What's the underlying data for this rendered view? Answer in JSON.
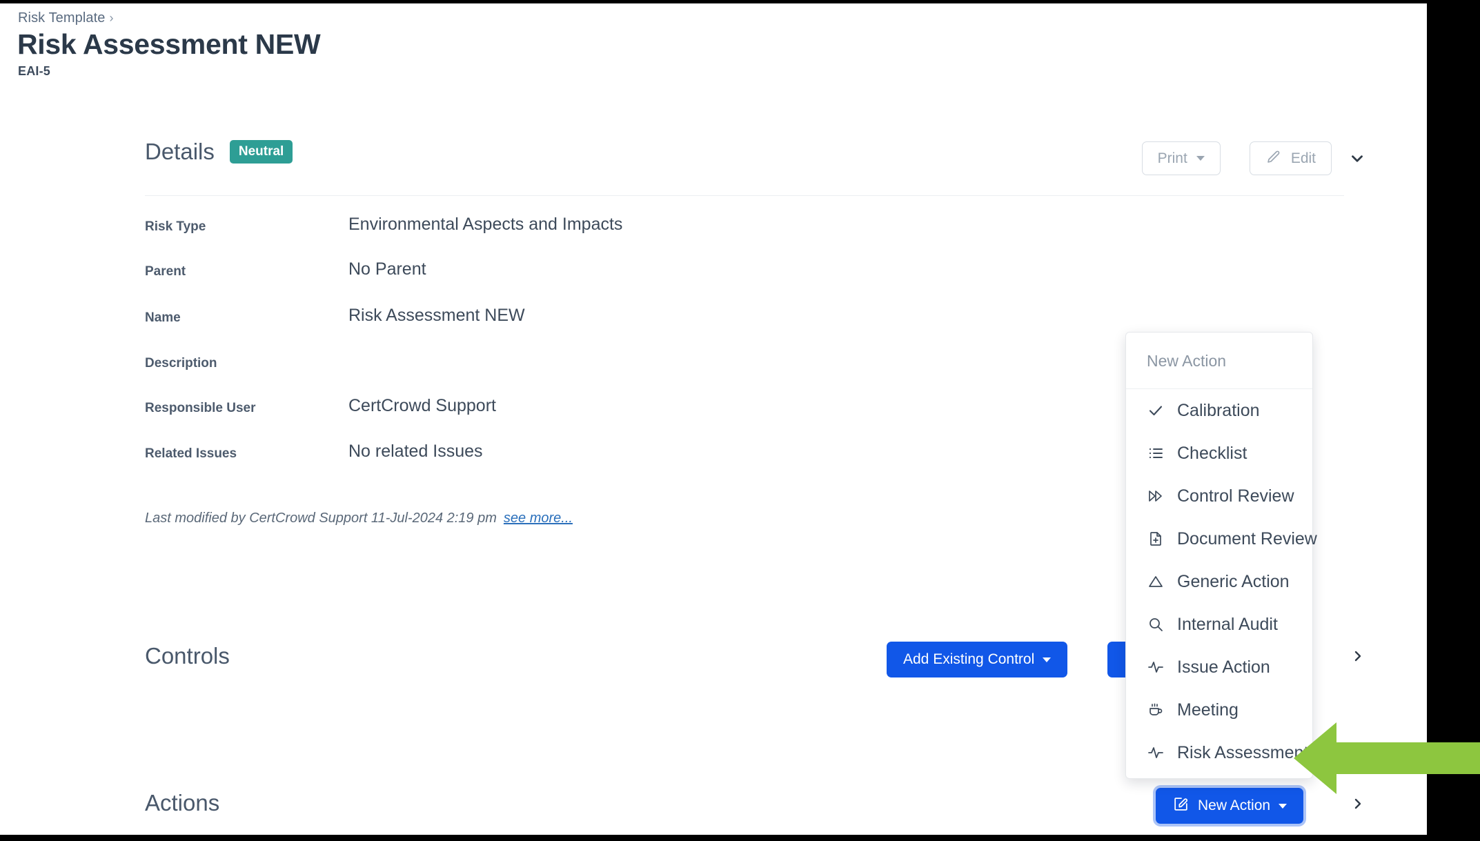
{
  "breadcrumb": {
    "label": "Risk Template",
    "separator": "›"
  },
  "header": {
    "title": "Risk Assessment NEW",
    "subtitle": "EAI-5"
  },
  "details": {
    "title": "Details",
    "status_badge": "Neutral",
    "status_color": "#2e9e95",
    "print_label": "Print",
    "edit_label": "Edit",
    "fields": [
      {
        "label": "Risk Type",
        "value": "Environmental Aspects and Impacts"
      },
      {
        "label": "Parent",
        "value": "No Parent"
      },
      {
        "label": "Name",
        "value": "Risk Assessment NEW"
      },
      {
        "label": "Description",
        "value": ""
      },
      {
        "label": "Responsible User",
        "value": "CertCrowd Support"
      },
      {
        "label": "Related Issues",
        "value": "No related Issues"
      }
    ],
    "last_modified": "Last modified by CertCrowd Support 11-Jul-2024 2:19 pm",
    "see_more_label": "see more..."
  },
  "controls_section": {
    "title": "Controls",
    "add_existing_label": "Add Existing Control"
  },
  "actions_section": {
    "title": "Actions",
    "new_action_label": "New Action"
  },
  "new_action_menu": {
    "header": "New Action",
    "items": [
      {
        "label": "Calibration",
        "icon": "check-icon"
      },
      {
        "label": "Checklist",
        "icon": "list-icon"
      },
      {
        "label": "Control Review",
        "icon": "fast-forward-icon"
      },
      {
        "label": "Document Review",
        "icon": "document-plus-icon"
      },
      {
        "label": "Generic Action",
        "icon": "triangle-icon"
      },
      {
        "label": "Internal Audit",
        "icon": "search-icon"
      },
      {
        "label": "Issue Action",
        "icon": "pulse-icon"
      },
      {
        "label": "Meeting",
        "icon": "coffee-cup-icon"
      },
      {
        "label": "Risk Assessment",
        "icon": "pulse-icon"
      }
    ]
  },
  "annotation": {
    "arrow_color": "#8dc63f",
    "points_to": "Risk Assessment"
  },
  "theme": {
    "primary_blue": "#1157e8",
    "text_dark": "#3d4a5a",
    "muted": "#8b96a3"
  }
}
